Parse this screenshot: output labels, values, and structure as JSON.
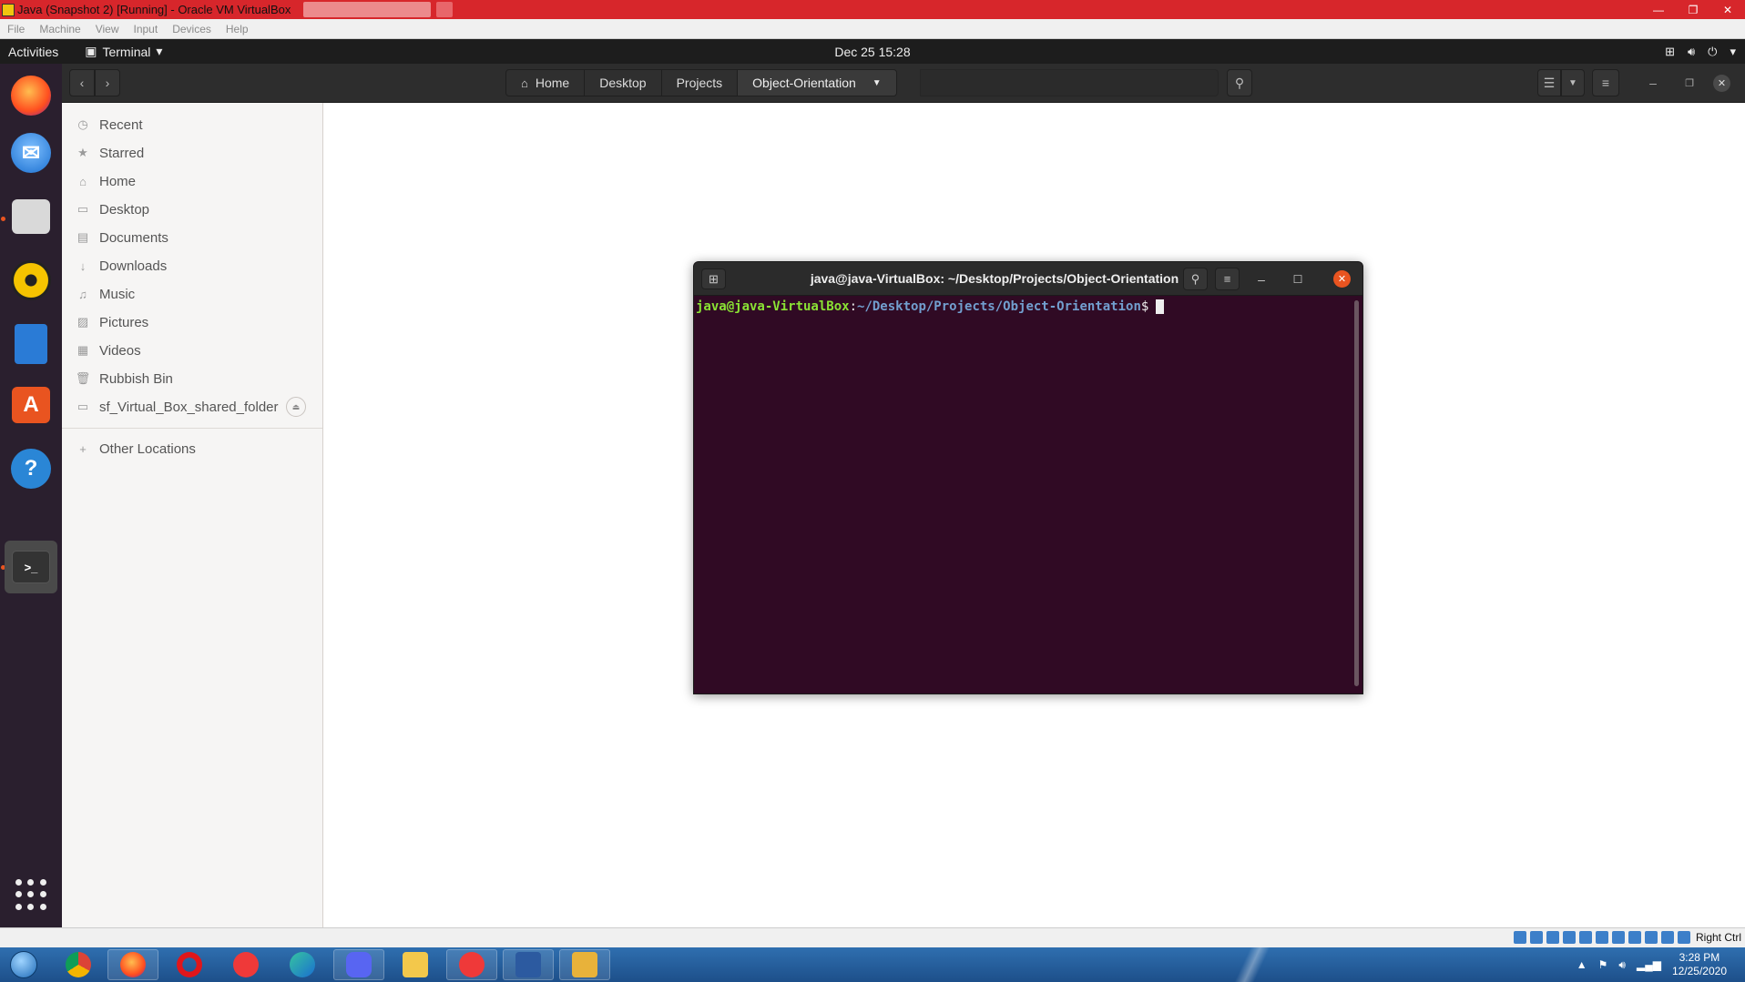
{
  "host_window": {
    "title": "Java (Snapshot 2) [Running] - Oracle VM VirtualBox",
    "controls": {
      "minimize": "—",
      "restore": "❐",
      "close": "✕"
    }
  },
  "vbox_menu": [
    "File",
    "Machine",
    "View",
    "Input",
    "Devices",
    "Help"
  ],
  "ubuntu_topbar": {
    "activities": "Activities",
    "app_menu": "Terminal",
    "clock": "Dec 25  15:28"
  },
  "files_window": {
    "breadcrumbs": [
      "Home",
      "Desktop",
      "Projects",
      "Object-Orientation"
    ],
    "sidebar": {
      "items": [
        {
          "label": "Recent",
          "icon": "clock-icon"
        },
        {
          "label": "Starred",
          "icon": "star-icon"
        },
        {
          "label": "Home",
          "icon": "home-icon"
        },
        {
          "label": "Desktop",
          "icon": "desktop-folder-icon"
        },
        {
          "label": "Documents",
          "icon": "documents-icon"
        },
        {
          "label": "Downloads",
          "icon": "downloads-icon"
        },
        {
          "label": "Music",
          "icon": "music-icon"
        },
        {
          "label": "Pictures",
          "icon": "pictures-icon"
        },
        {
          "label": "Videos",
          "icon": "videos-icon"
        },
        {
          "label": "Rubbish Bin",
          "icon": "trash-icon"
        }
      ],
      "drive": {
        "label": "sf_Virtual_Box_shared_folder",
        "icon": "drive-icon"
      },
      "other": {
        "label": "Other Locations",
        "icon": "plus-icon"
      }
    }
  },
  "terminal": {
    "title": "java@java-VirtualBox: ~/Desktop/Projects/Object-Orientation",
    "prompt_user": "java@java-VirtualBox",
    "prompt_sep": ":",
    "prompt_path": "~/Desktop/Projects/Object-Orientation",
    "prompt_symbol": "$"
  },
  "vbox_status": {
    "host_key": "Right Ctrl"
  },
  "taskbar": {
    "time": "3:28 PM",
    "date": "12/25/2020"
  },
  "colors": {
    "terminal_bg": "#300a24",
    "prompt_user": "#8ae234",
    "prompt_path": "#729fcf",
    "ubuntu_orange": "#e95420",
    "vbox_title": "#d7262b"
  }
}
